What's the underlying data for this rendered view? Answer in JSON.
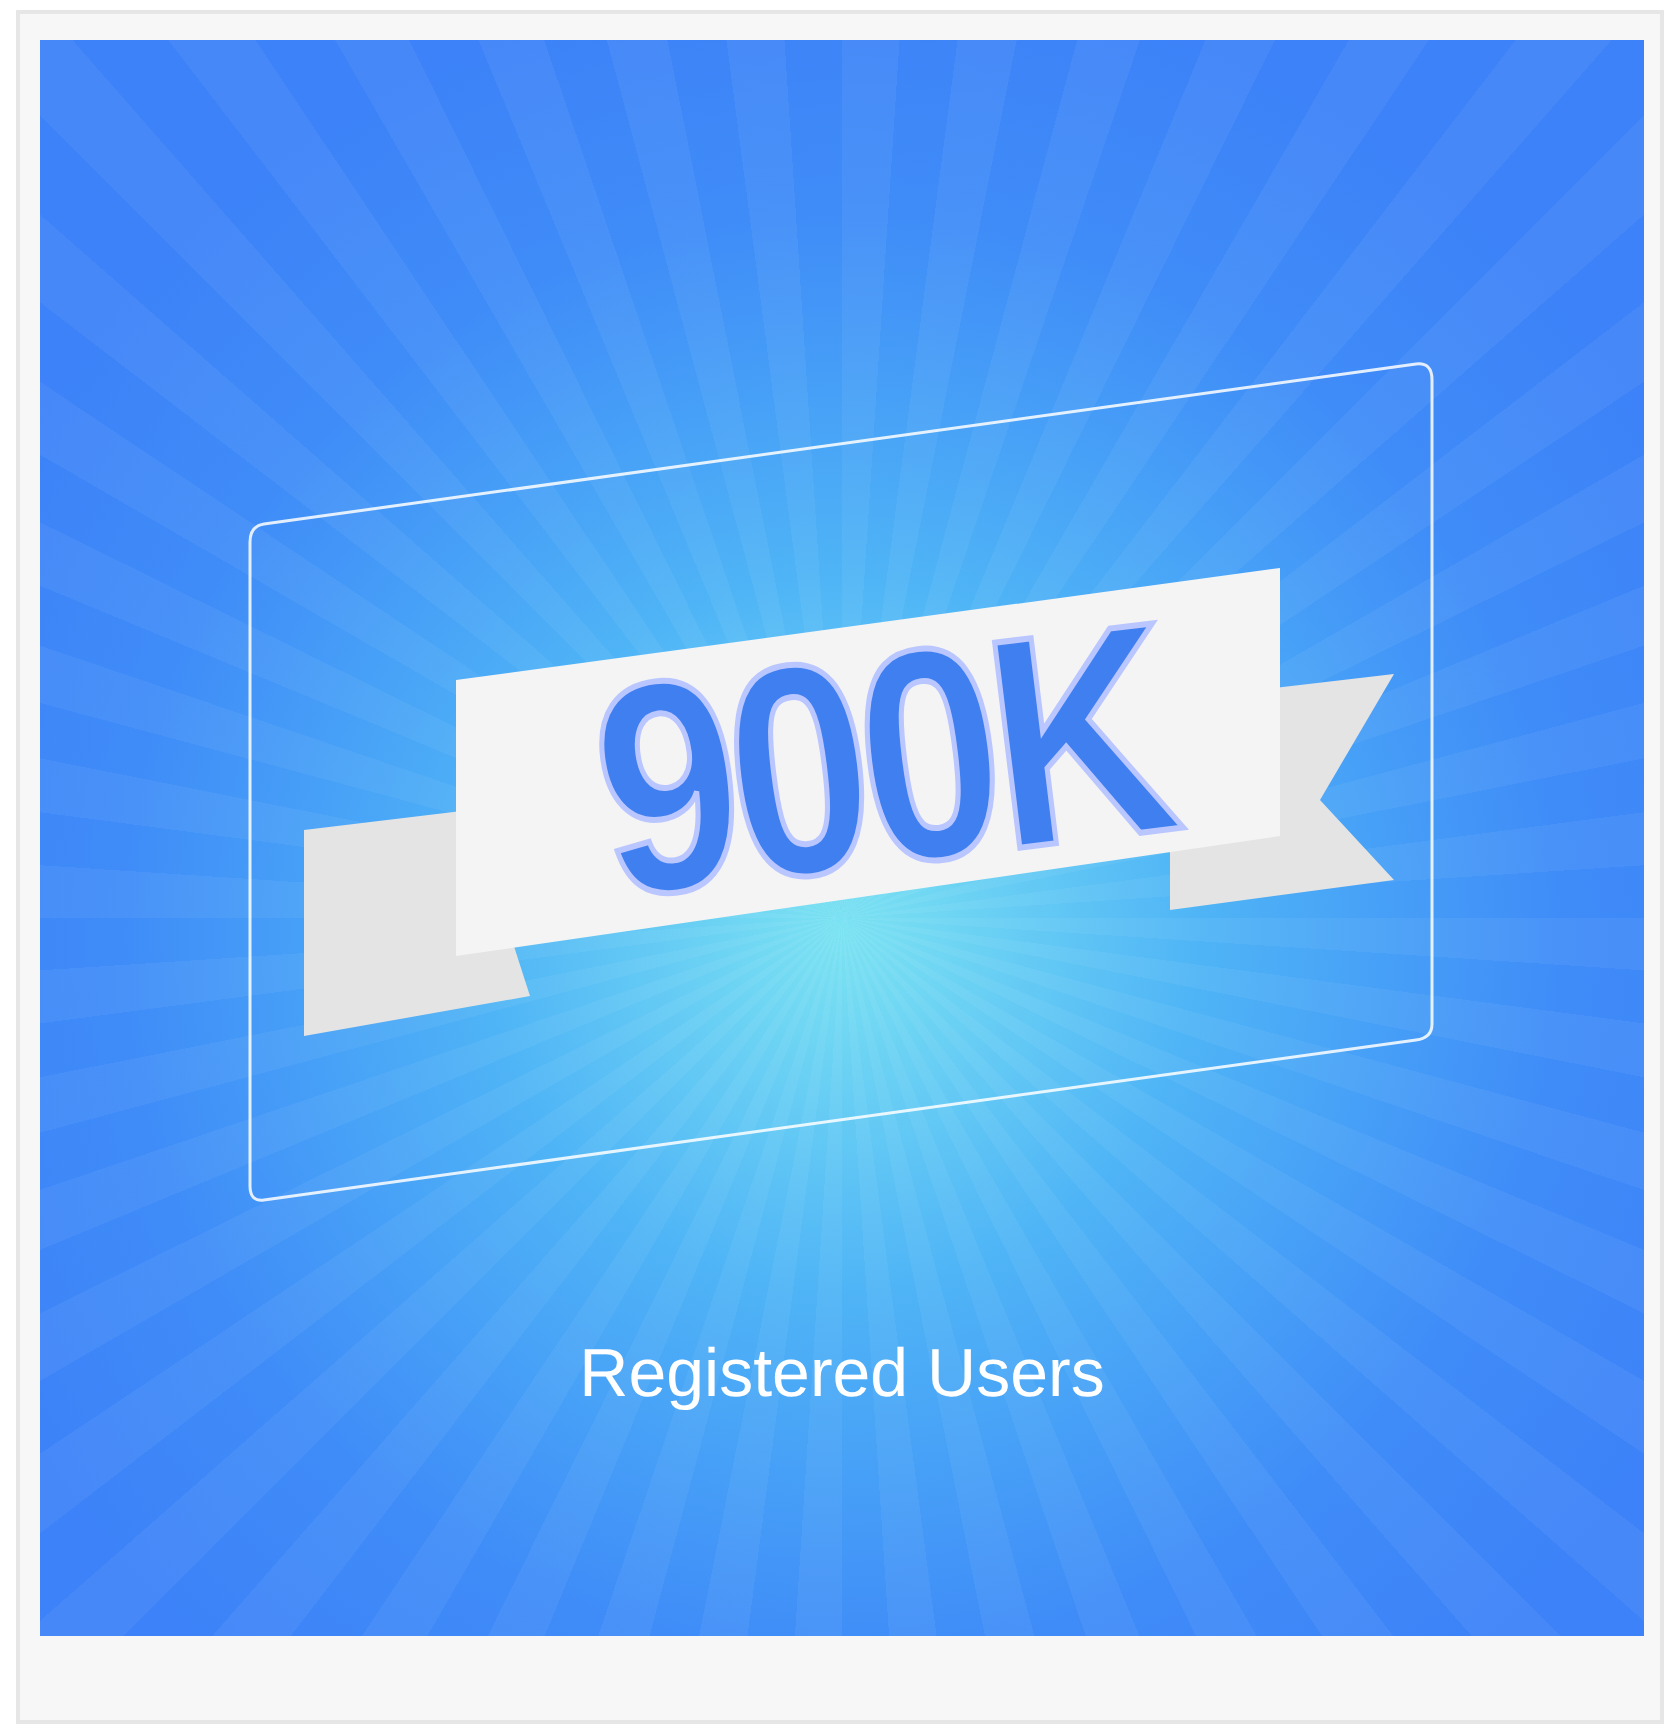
{
  "card": {
    "graphic": {
      "value": "900K",
      "caption": "Registered Users"
    }
  }
}
